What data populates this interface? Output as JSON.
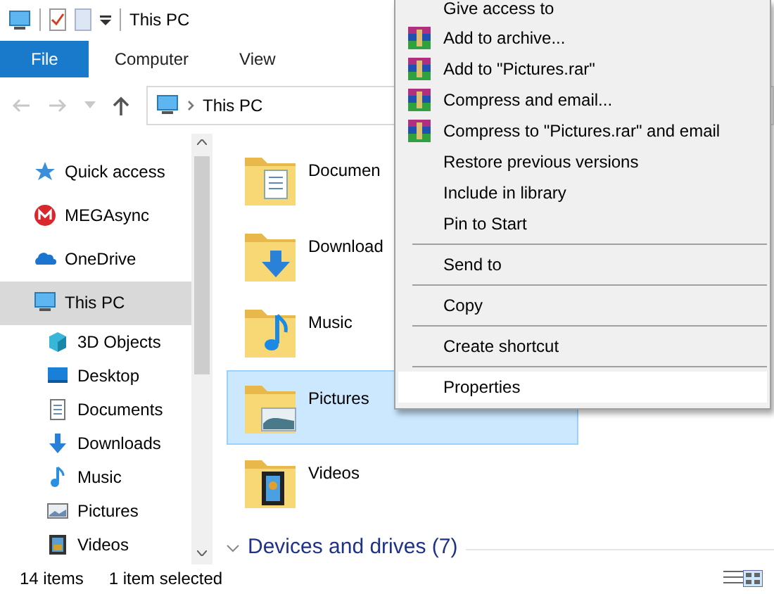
{
  "window": {
    "title": "This PC"
  },
  "ribbon_tabs": [
    {
      "label": "File",
      "selected": true
    },
    {
      "label": "Computer",
      "selected": false
    },
    {
      "label": "View",
      "selected": false
    }
  ],
  "address_bar": {
    "path": "This PC"
  },
  "sidebar": {
    "items": [
      {
        "label": "Quick access",
        "selected": false
      },
      {
        "label": "MEGAsync",
        "selected": false
      },
      {
        "label": "OneDrive",
        "selected": false
      },
      {
        "label": "This PC",
        "selected": true,
        "children": [
          {
            "label": "3D Objects",
            "selected": false
          },
          {
            "label": "Desktop",
            "selected": false
          },
          {
            "label": "Documents",
            "selected": false
          },
          {
            "label": "Downloads",
            "selected": false
          },
          {
            "label": "Music",
            "selected": false
          },
          {
            "label": "Pictures",
            "selected": false
          },
          {
            "label": "Videos",
            "selected": false
          }
        ]
      }
    ]
  },
  "folders": [
    {
      "label": "Documen",
      "selected": false
    },
    {
      "label": "Download",
      "selected": false
    },
    {
      "label": "Music",
      "selected": false
    },
    {
      "label": "Pictures",
      "selected": true
    },
    {
      "label": "Videos",
      "selected": false
    }
  ],
  "group_header": {
    "label": "Devices and drives (7)",
    "expanded": true
  },
  "status_bar": {
    "item_count": "14 items",
    "selection": "1 item selected"
  },
  "context_menu": {
    "items": [
      {
        "kind": "plain",
        "label": "Give access to",
        "selected": false
      },
      {
        "kind": "archive",
        "label": "Add to archive...",
        "selected": false
      },
      {
        "kind": "archive",
        "label": "Add to \"Pictures.rar\"",
        "selected": false
      },
      {
        "kind": "archive",
        "label": "Compress and email...",
        "selected": false
      },
      {
        "kind": "archive",
        "label": "Compress to \"Pictures.rar\" and email",
        "selected": false
      },
      {
        "kind": "plain",
        "label": "Restore previous versions",
        "selected": false
      },
      {
        "kind": "plain",
        "label": "Include in library",
        "selected": false
      },
      {
        "kind": "plain",
        "label": "Pin to Start",
        "selected": false
      },
      {
        "kind": "separator"
      },
      {
        "kind": "plain",
        "label": "Send to",
        "selected": false
      },
      {
        "kind": "separator"
      },
      {
        "kind": "plain",
        "label": "Copy",
        "selected": false
      },
      {
        "kind": "separator"
      },
      {
        "kind": "plain",
        "label": "Create shortcut",
        "selected": false
      },
      {
        "kind": "separator"
      },
      {
        "kind": "plain",
        "label": "Properties",
        "selected": true
      }
    ]
  }
}
